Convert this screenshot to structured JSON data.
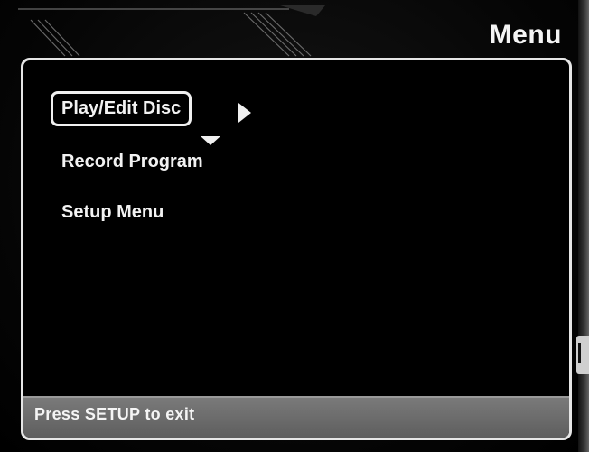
{
  "header": {
    "title": "Menu"
  },
  "menu": {
    "items": [
      {
        "label": "Play/Edit Disc",
        "selected": true
      },
      {
        "label": "Record Program",
        "selected": false
      },
      {
        "label": "Setup Menu",
        "selected": false
      }
    ],
    "indicators": {
      "right": "arrow-right-icon",
      "down": "arrow-down-icon"
    }
  },
  "status_bar": {
    "text": "Press SETUP to exit"
  },
  "colors": {
    "background": "#000000",
    "foreground": "#f2f2f2",
    "status_bar": "#6a6a6a"
  }
}
